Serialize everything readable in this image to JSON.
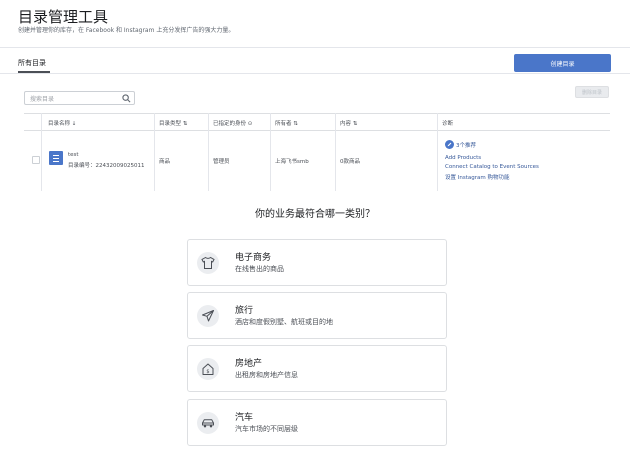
{
  "header": {
    "title": "目录管理工具",
    "subtitle": "创建并管理你的库存，在 Facebook 和 Instagram 上充分发挥广告的强大力量。"
  },
  "tabs": [
    {
      "label": "所有目录",
      "active": true
    }
  ],
  "toolbar": {
    "create_label": "创建目录",
    "delete_label": "删除目录",
    "search_placeholder": "搜索目录"
  },
  "table": {
    "columns": {
      "name": "目录名称 ↓",
      "type": "目录类型 ⇅",
      "role": "已指定的身份 ⊙",
      "owner": "所有者 ⇅",
      "content": "内容 ⇅",
      "diagnostics": "诊断"
    },
    "row": {
      "name": "test",
      "id": "目录编号：22432009025011",
      "type": "商品",
      "role": "管理员",
      "owner": "上海飞书smb",
      "content": "0款商品",
      "diagnostics_issue": "3个推荐",
      "links": [
        "Add Products",
        "Connect Catalog to Event Sources",
        "设置 Instagram 购物功能"
      ]
    }
  },
  "question": "你的业务最符合哪一类别？",
  "categories": [
    {
      "title": "电子商务",
      "desc": "在线售出的商品",
      "icon": "tshirt-icon"
    },
    {
      "title": "旅行",
      "desc": "酒店和度假别墅、航班或目的地",
      "icon": "airplane-icon"
    },
    {
      "title": "房地产",
      "desc": "出租房和房地产信息",
      "icon": "house-icon"
    },
    {
      "title": "汽车",
      "desc": "汽车市场的不同层级",
      "icon": "car-icon"
    }
  ],
  "colors": {
    "accent": "#4a76c9",
    "link": "#365899"
  }
}
